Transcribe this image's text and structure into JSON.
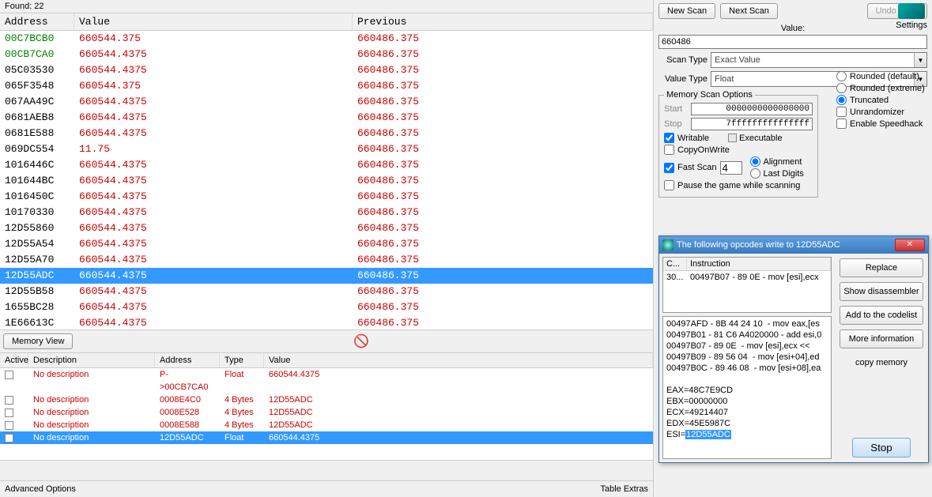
{
  "found_label": "Found: 22",
  "columns": {
    "address": "Address",
    "value": "Value",
    "previous": "Previous"
  },
  "rows": [
    {
      "addr": "00C7BCB0",
      "addr_green": true,
      "val": "660544.375",
      "prev": "660486.375",
      "sel": false
    },
    {
      "addr": "00CB7CA0",
      "addr_green": true,
      "val": "660544.4375",
      "prev": "660486.375",
      "sel": false
    },
    {
      "addr": "05C03530",
      "val": "660544.4375",
      "prev": "660486.375",
      "sel": false
    },
    {
      "addr": "065F3548",
      "val": "660544.375",
      "prev": "660486.375",
      "sel": false
    },
    {
      "addr": "067AA49C",
      "val": "660544.4375",
      "prev": "660486.375",
      "sel": false
    },
    {
      "addr": "0681AEB8",
      "val": "660544.4375",
      "prev": "660486.375",
      "sel": false
    },
    {
      "addr": "0681E588",
      "val": "660544.4375",
      "prev": "660486.375",
      "sel": false
    },
    {
      "addr": "069DC554",
      "val": "11.75",
      "prev": "660486.375",
      "sel": false
    },
    {
      "addr": "1016446C",
      "val": "660544.4375",
      "prev": "660486.375",
      "sel": false
    },
    {
      "addr": "101644BC",
      "val": "660544.4375",
      "prev": "660486.375",
      "sel": false
    },
    {
      "addr": "1016450C",
      "val": "660544.4375",
      "prev": "660486.375",
      "sel": false
    },
    {
      "addr": "10170330",
      "val": "660544.4375",
      "prev": "660486.375",
      "sel": false
    },
    {
      "addr": "12D55860",
      "val": "660544.4375",
      "prev": "660486.375",
      "sel": false
    },
    {
      "addr": "12D55A54",
      "val": "660544.4375",
      "prev": "660486.375",
      "sel": false
    },
    {
      "addr": "12D55A70",
      "val": "660544.4375",
      "prev": "660486.375",
      "sel": false
    },
    {
      "addr": "12D55ADC",
      "val": "660544.4375",
      "prev": "660486.375",
      "sel": true
    },
    {
      "addr": "12D55B58",
      "val": "660544.4375",
      "prev": "660486.375",
      "sel": false
    },
    {
      "addr": "1655BC28",
      "val": "660544.4375",
      "prev": "660486.375",
      "sel": false
    },
    {
      "addr": "1E66613C",
      "val": "660544.4375",
      "prev": "660486.375",
      "sel": false
    }
  ],
  "memory_view_btn": "Memory View",
  "addr_list_cols": {
    "active": "Active",
    "desc": "Description",
    "addr": "Address",
    "type": "Type",
    "val": "Value"
  },
  "addr_list": [
    {
      "desc": "No description",
      "addr": "P->00CB7CA0",
      "type": "Float",
      "val": "660544.4375",
      "sel": false
    },
    {
      "desc": "No description",
      "addr": "0008E4C0",
      "type": "4 Bytes",
      "val": "12D55ADC",
      "sel": false
    },
    {
      "desc": "No description",
      "addr": "0008E528",
      "type": "4 Bytes",
      "val": "12D55ADC",
      "sel": false
    },
    {
      "desc": "No description",
      "addr": "0008E588",
      "type": "4 Bytes",
      "val": "12D55ADC",
      "sel": false
    },
    {
      "desc": "No description",
      "addr": "12D55ADC",
      "type": "Float",
      "val": "660544.4375",
      "sel": true
    }
  ],
  "advanced_options": "Advanced Options",
  "table_extras": "Table Extras",
  "scan": {
    "new_scan": "New Scan",
    "next_scan": "Next Scan",
    "undo_scan": "Undo Scan",
    "value_label": "Value:",
    "value": "660486",
    "scan_type_label": "Scan Type",
    "scan_type": "Exact Value",
    "value_type_label": "Value Type",
    "value_type": "Float",
    "mso_legend": "Memory Scan Options",
    "start_label": "Start",
    "start": "0000000000000000",
    "stop_label": "Stop",
    "stop": "7fffffffffffffff",
    "writable": "Writable",
    "executable": "Executable",
    "copyonwrite": "CopyOnWrite",
    "fast_scan": "Fast Scan",
    "fast_scan_val": "4",
    "alignment": "Alignment",
    "last_digits": "Last Digits",
    "pause": "Pause the game while scanning",
    "rounded_default": "Rounded (default)",
    "rounded_extreme": "Rounded (extreme)",
    "truncated": "Truncated",
    "unrandomizer": "Unrandomizer",
    "speedhack": "Enable Speedhack",
    "settings": "Settings"
  },
  "opcode_win": {
    "title": "The following opcodes write to 12D55ADC",
    "col_c": "C...",
    "col_instr": "Instruction",
    "row_c": "30...",
    "row_instr": "00497B07 - 89 0E  - mov [esi],ecx",
    "dis_lines": [
      "00497AFD - 8B 44 24 10  - mov eax,[es",
      "00497B01 - 81 C6 A4020000 - add esi,0",
      "00497B07 - 89 0E  - mov [esi],ecx <<",
      "00497B09 - 89 56 04  - mov [esi+04],ed",
      "00497B0C - 89 46 08  - mov [esi+08],ea"
    ],
    "regs": [
      "EAX=48C7E9CD",
      "EBX=00000000",
      "ECX=49214407",
      "EDX=45E5987C"
    ],
    "esi_label": "ESI=",
    "esi_val": "12D55ADC",
    "btn_replace": "Replace",
    "btn_dis": "Show disassembler",
    "btn_codelist": "Add to the codelist",
    "btn_more": "More information",
    "copy_memory": "copy memory",
    "stop": "Stop"
  }
}
